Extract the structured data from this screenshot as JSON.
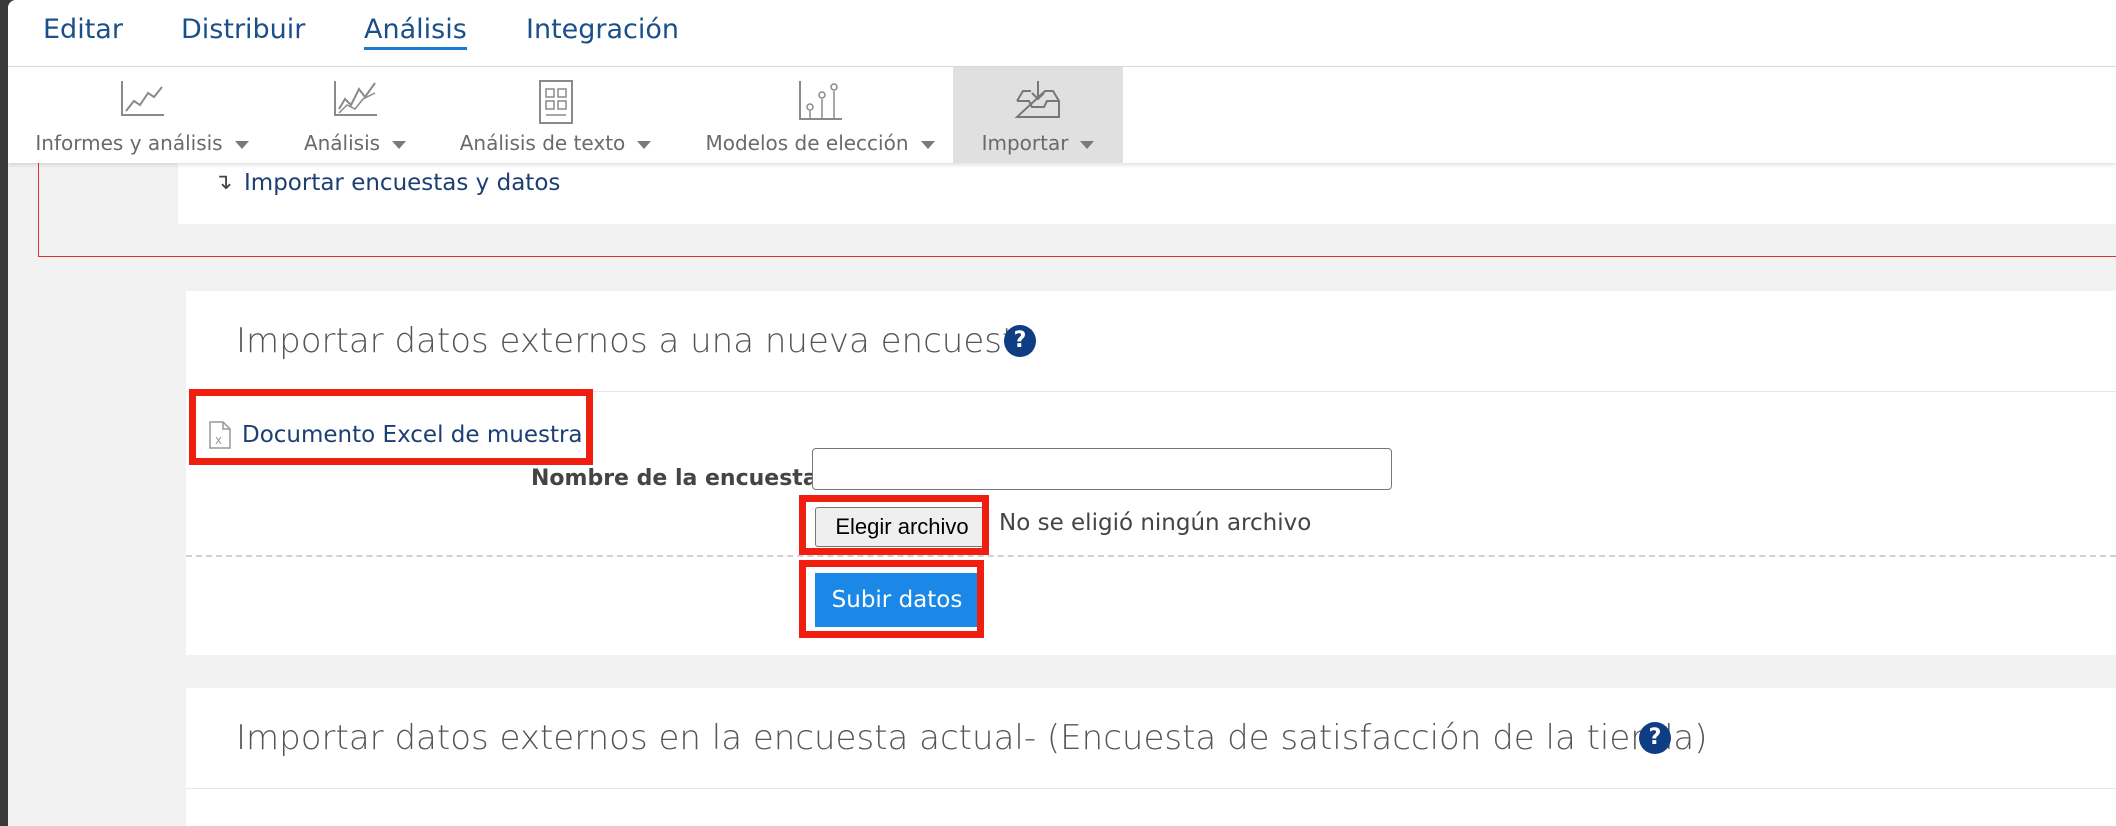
{
  "topnav": {
    "tabs": [
      {
        "label": "Editar"
      },
      {
        "label": "Distribuir"
      },
      {
        "label": "Análisis",
        "active": true
      },
      {
        "label": "Integración"
      }
    ]
  },
  "toolbar": {
    "items": [
      {
        "label": "Informes y análisis",
        "icon": "line-chart-icon"
      },
      {
        "label": "Análisis",
        "icon": "trend-chart-icon"
      },
      {
        "label": "Análisis de texto",
        "icon": "text-document-icon"
      },
      {
        "label": "Modelos de elección",
        "icon": "scatter-chart-icon"
      },
      {
        "label": "Importar",
        "icon": "inbox-download-icon",
        "selected": true
      }
    ]
  },
  "import_link": {
    "label": "Importar encuestas y datos",
    "icon": "arrow-down-icon"
  },
  "new_survey": {
    "title": "Importar datos externos a una nueva encuesta",
    "sample_link": "Documento Excel de muestra",
    "name_label": "Nombre de la encuesta",
    "name_value": "",
    "choose_file": "Elegir archivo",
    "no_file": "No se eligió ningún archivo",
    "upload": "Subir datos",
    "help": "?"
  },
  "current_survey": {
    "title": "Importar datos externos en la encuesta actual- (Encuesta de satisfacción de la tienda)",
    "help": "?"
  },
  "colors": {
    "brand_blue": "#1b4f8c",
    "button_blue": "#1b87e6",
    "highlight_red": "#f01e0e",
    "help_blue": "#0e3d84"
  }
}
